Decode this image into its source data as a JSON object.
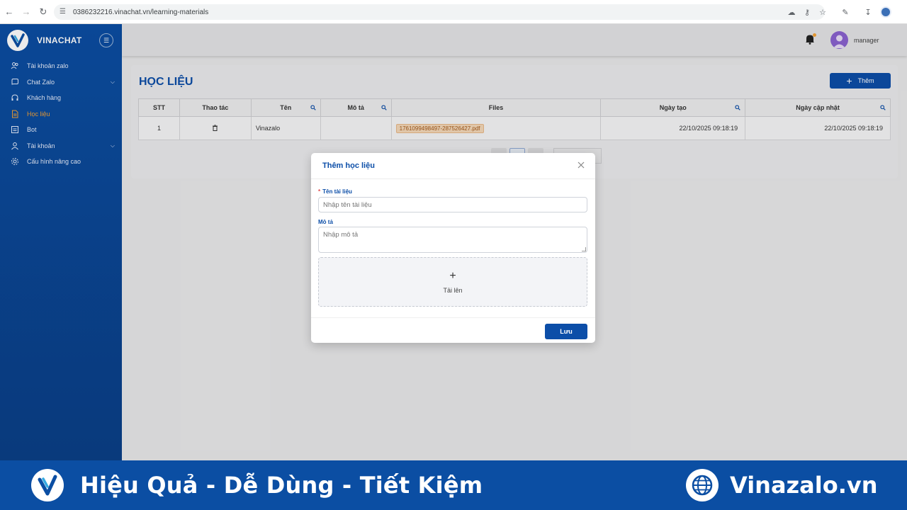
{
  "browser": {
    "url": "0386232216.vinachat.vn/learning-materials"
  },
  "sidebar": {
    "brand": "VINACHAT",
    "items": [
      {
        "label": "Tài khoản zalo",
        "icon": "users-icon",
        "active": false,
        "expandable": false
      },
      {
        "label": "Chat Zalo",
        "icon": "chat-icon",
        "active": false,
        "expandable": true
      },
      {
        "label": "Khách hàng",
        "icon": "headset-icon",
        "active": false,
        "expandable": false
      },
      {
        "label": "Học liệu",
        "icon": "document-icon",
        "active": true,
        "expandable": false
      },
      {
        "label": "Bot",
        "icon": "bot-icon",
        "active": false,
        "expandable": false
      },
      {
        "label": "Tài khoản",
        "icon": "user-icon",
        "active": false,
        "expandable": true
      },
      {
        "label": "Cấu hình nâng cao",
        "icon": "gear-icon",
        "active": false,
        "expandable": false
      }
    ]
  },
  "header": {
    "username": "manager"
  },
  "page": {
    "title": "HỌC LIỆU",
    "add_label": "Thêm"
  },
  "table": {
    "columns": [
      "STT",
      "Thao tác",
      "Tên",
      "Mô tả",
      "Files",
      "Ngày tạo",
      "Ngày cập nhật"
    ],
    "rows": [
      {
        "stt": "1",
        "name": "Vinazalo",
        "description": "",
        "file": "1761099498497-287526427.pdf",
        "created": "22/10/2025 09:18:19",
        "updated": "22/10/2025 09:18:19"
      }
    ]
  },
  "modal": {
    "title": "Thêm học liệu",
    "name_label": "Tên tài liệu",
    "name_placeholder": "Nhập tên tài liệu",
    "desc_label": "Mô tả",
    "desc_placeholder": "Nhập mô tả",
    "upload_label": "Tải lên",
    "save_label": "Lưu"
  },
  "banner": {
    "slogan": "Hiệu Quả - Dễ Dùng - Tiết Kiệm",
    "site": "Vinazalo.vn"
  },
  "colors": {
    "primary": "#0c4ea8",
    "accent": "#f4a236",
    "sidebar": "#0b4ea3"
  }
}
